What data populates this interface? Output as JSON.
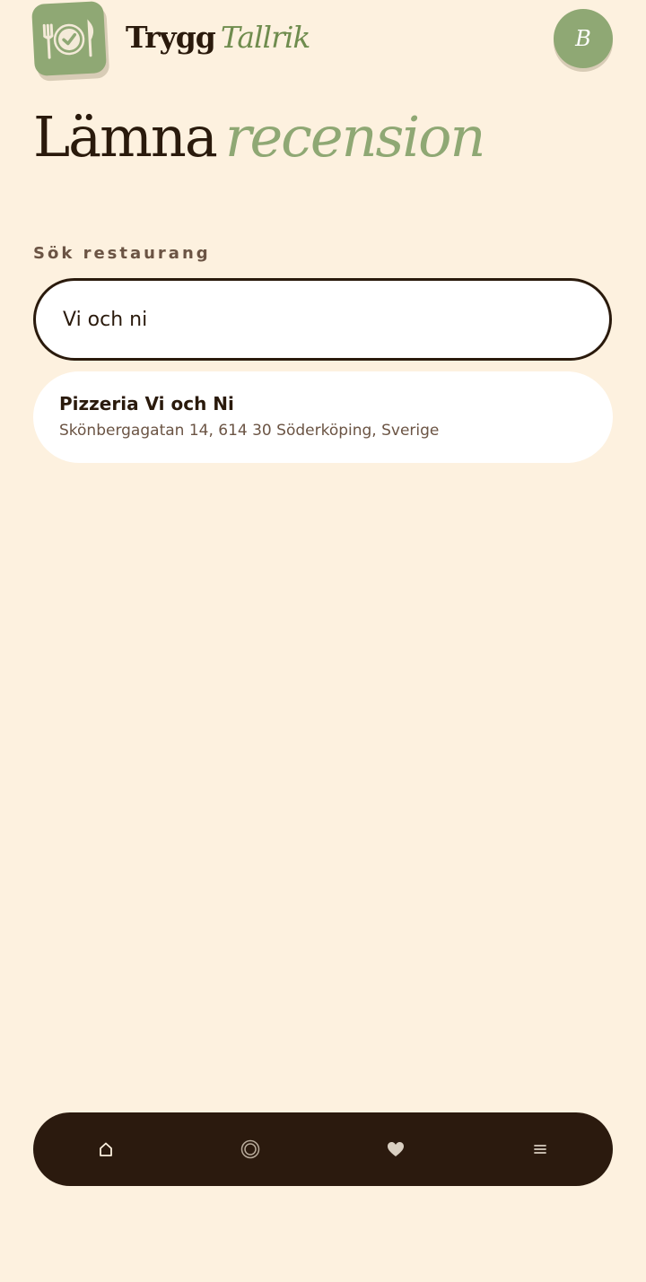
{
  "brand": {
    "word1": "Trygg",
    "word2": "Tallrik"
  },
  "avatar": {
    "initial": "B"
  },
  "page": {
    "title_plain": "Lämna",
    "title_italic": "recension"
  },
  "search": {
    "label": "Sök restaurang",
    "value": "Vi och ni"
  },
  "results": [
    {
      "name": "Pizzeria Vi och Ni",
      "address": "Skönbergagatan 14, 614 30 Söderköping, Sverige"
    }
  ],
  "nav": [
    {
      "icon": "home-icon"
    },
    {
      "icon": "review-circle-icon"
    },
    {
      "icon": "heart-icon"
    },
    {
      "icon": "menu-icon"
    }
  ],
  "colors": {
    "background": "#fdf1df",
    "accent_green": "#8fa874",
    "dark": "#2b1a0e"
  }
}
